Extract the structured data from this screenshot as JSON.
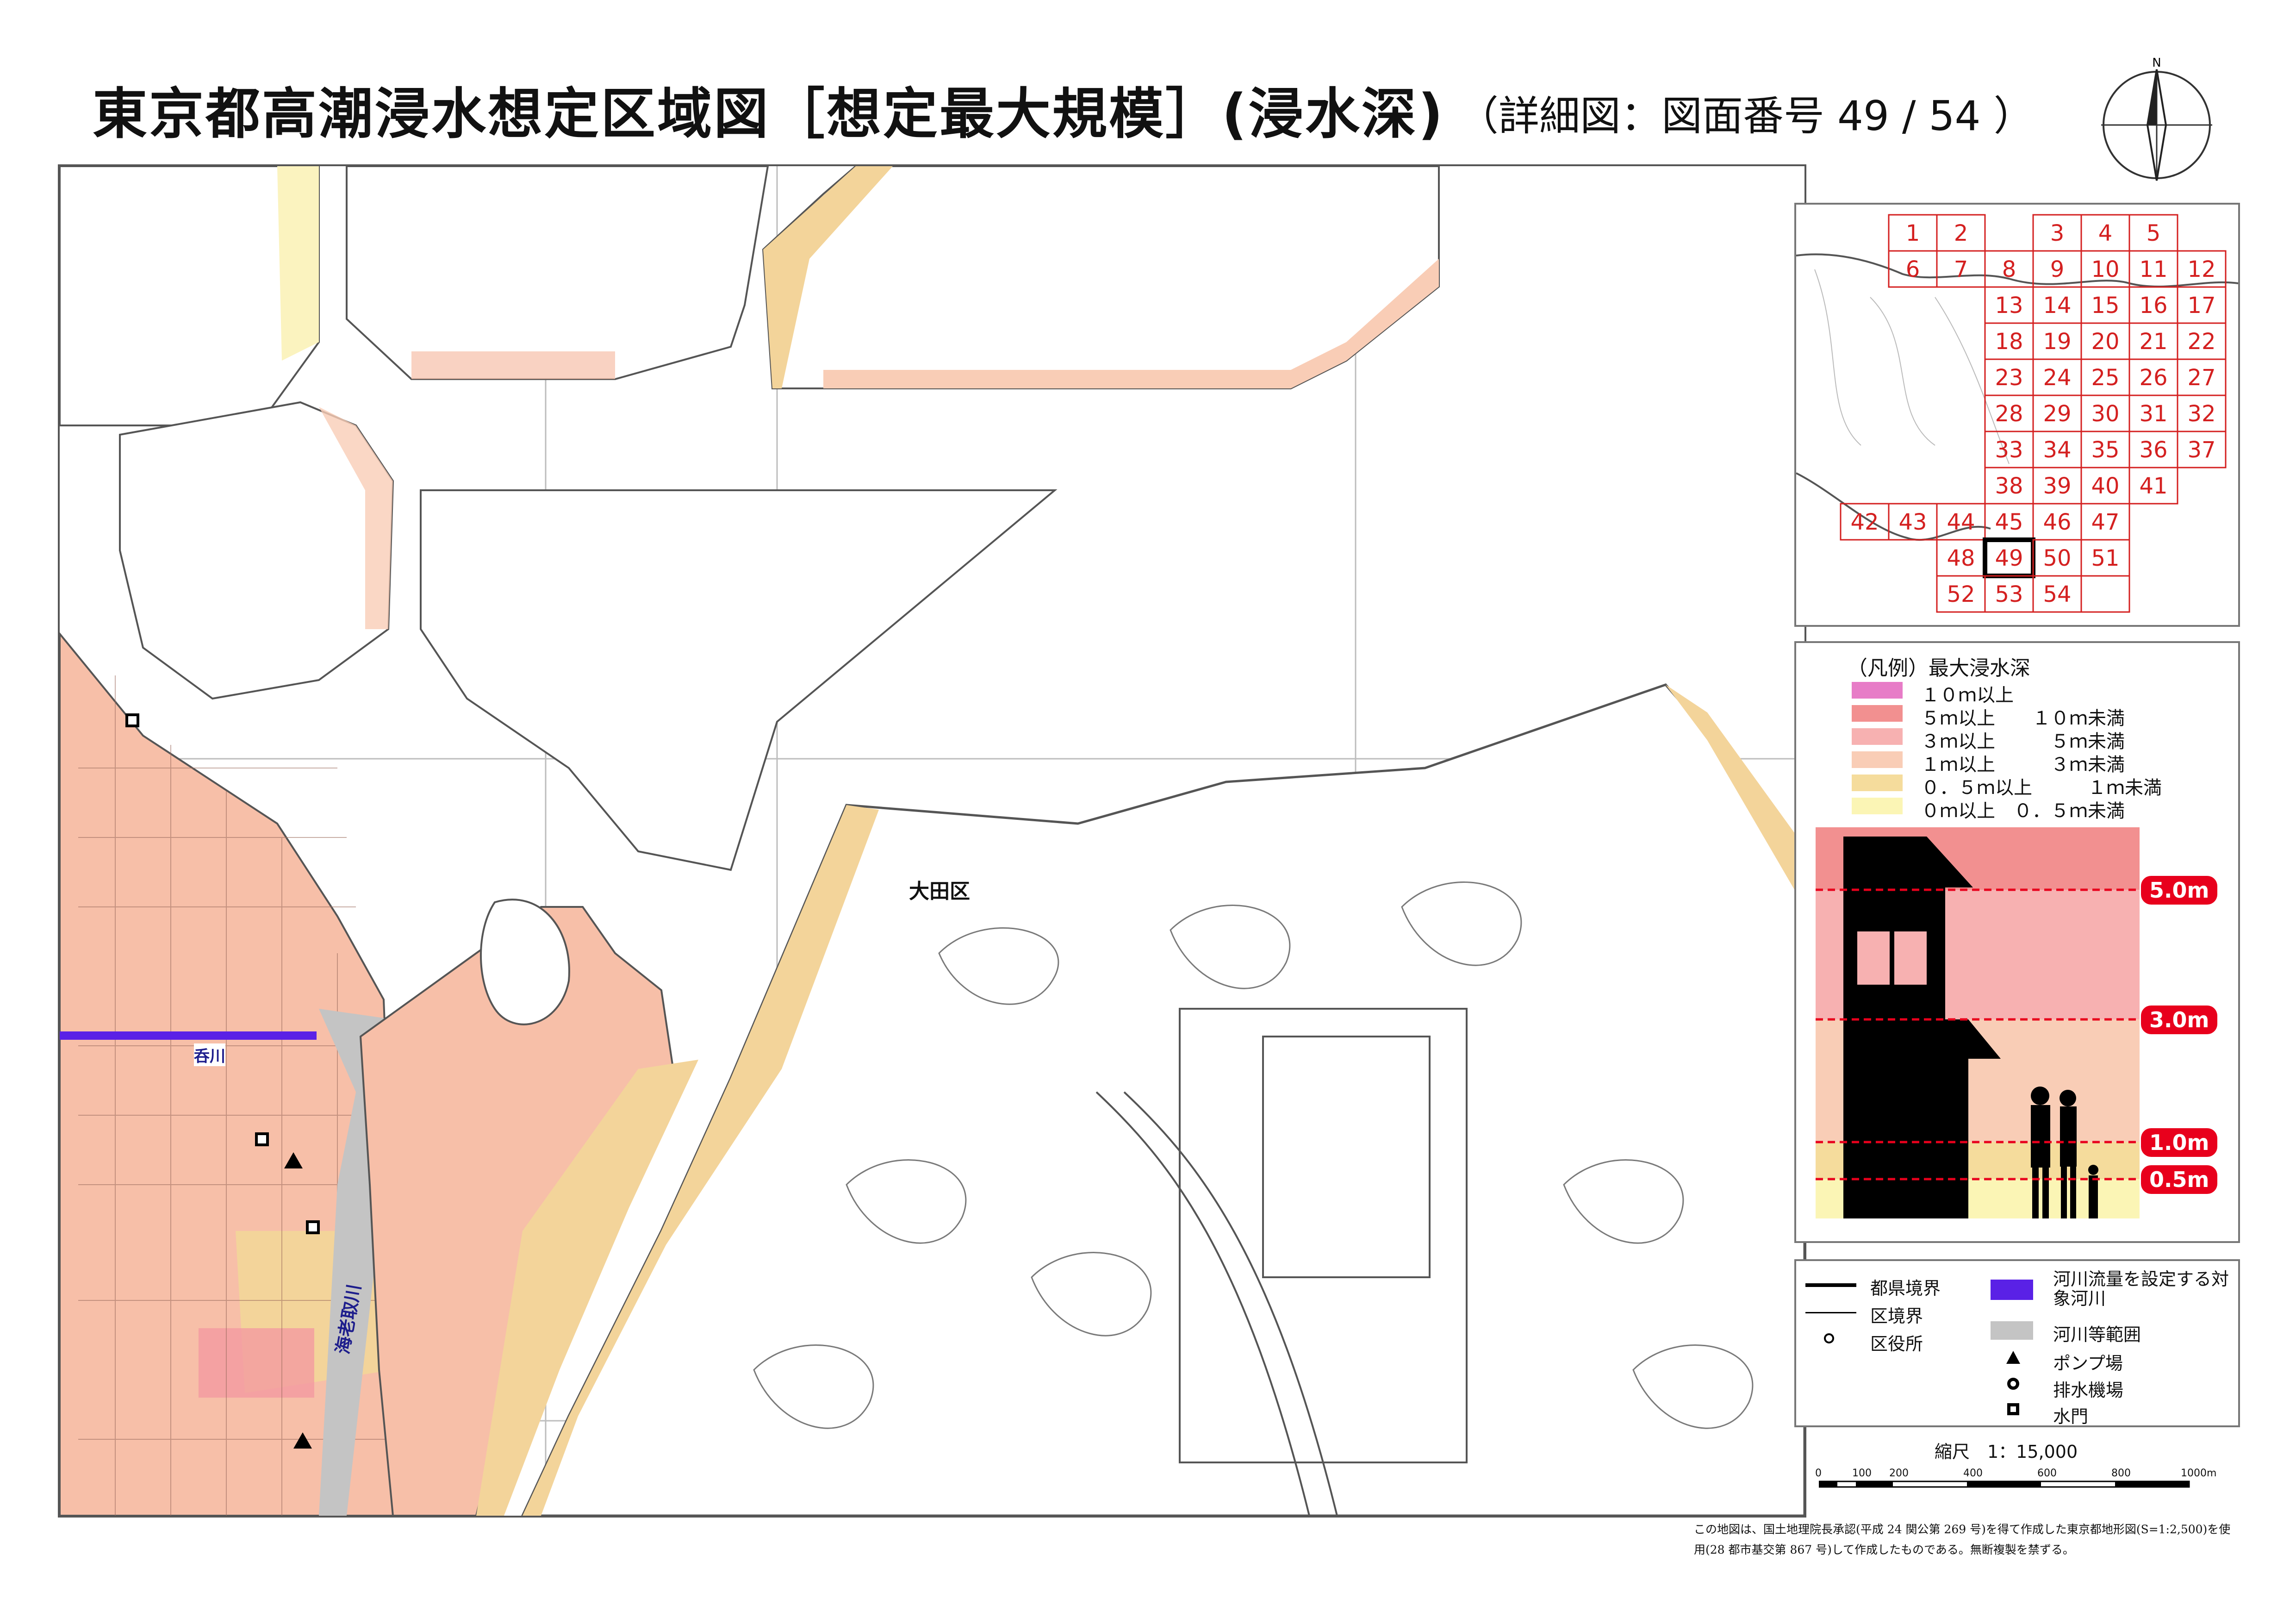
{
  "header": {
    "title": "東京都高潮浸水想定区域図［想定最大規模］(浸水深)",
    "subtitle": "（詳細図：図面番号 49 / 54 ）",
    "north_label": "N"
  },
  "map": {
    "ward_label": "大田区",
    "river_label_1": "呑川",
    "river_label_2": "海老取川",
    "colors": {
      "depth_0_05": "#fbf3bf",
      "depth_05_1": "#f5dc9c",
      "depth_1_3": "#f7c3ab",
      "depth_3_5": "#f4a9a9",
      "depth_5_10": "#f29090",
      "depth_10": "#e77cc7",
      "river_flow": "#5a21e6",
      "river_area": "#c4c4c4"
    }
  },
  "index_map": {
    "current_sheet": "49",
    "sheets": [
      "1",
      "2",
      "3",
      "4",
      "5",
      "6",
      "7",
      "8",
      "9",
      "10",
      "11",
      "12",
      "13",
      "14",
      "15",
      "16",
      "17",
      "18",
      "19",
      "20",
      "21",
      "22",
      "23",
      "24",
      "25",
      "26",
      "27",
      "28",
      "29",
      "30",
      "31",
      "32",
      "33",
      "34",
      "35",
      "36",
      "37",
      "38",
      "39",
      "40",
      "41",
      "42",
      "43",
      "44",
      "45",
      "46",
      "47",
      "48",
      "49",
      "50",
      "51",
      "52",
      "53",
      "54"
    ]
  },
  "legend": {
    "title": "（凡例）最大浸水深",
    "rows": [
      {
        "label": "１０ｍ以上",
        "color": "#e77cc7"
      },
      {
        "label": "５ｍ以上　　１０ｍ未満",
        "color": "#f29090"
      },
      {
        "label": "３ｍ以上　　　５ｍ未満",
        "color": "#f7b1b1"
      },
      {
        "label": "１ｍ以上　　　３ｍ未満",
        "color": "#f9cdb6"
      },
      {
        "label": "０．５ｍ以上　　　１ｍ未満",
        "color": "#f5dc9c"
      },
      {
        "label": "０ｍ以上　０．５ｍ未満",
        "color": "#fbf5b5"
      }
    ],
    "depth_tags": [
      "5.0m",
      "3.0m",
      "1.0m",
      "0.5m"
    ]
  },
  "symbols": {
    "pref_boundary": "都県境界",
    "ward_boundary": "区境界",
    "ward_office": "区役所",
    "river_flow": "河川流量を設定する対象河川",
    "river_area": "河川等範囲",
    "pump_station": "ポンプ場",
    "drainage_station": "排水機場",
    "water_gate": "水門"
  },
  "scale": {
    "title": "縮尺　1：15,000",
    "ticks": [
      "0",
      "100",
      "200",
      "400",
      "600",
      "800",
      "1000m"
    ]
  },
  "credit": "この地図は、国土地理院長承認(平成 24 関公第 269 号)を得て作成した東京都地形図(S=1:2,500)を使用(28 都市基交第 867 号)して作成したものである。無断複製を禁ずる。"
}
